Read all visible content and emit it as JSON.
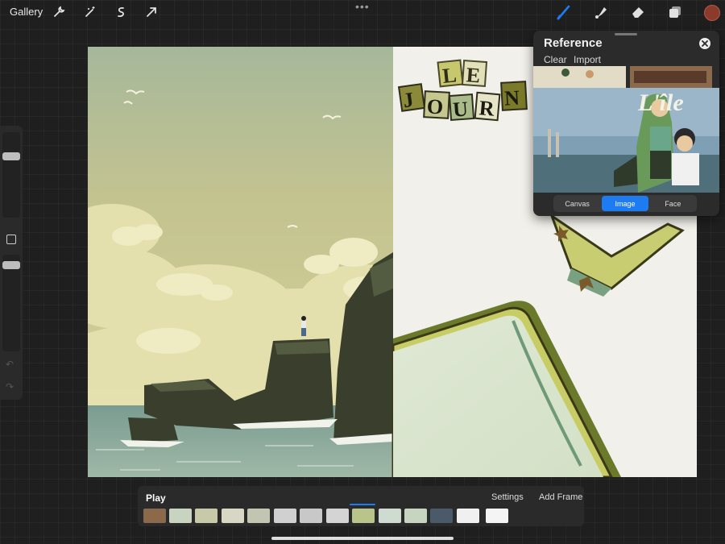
{
  "toolbar": {
    "gallery_label": "Gallery",
    "left_icons": [
      "wrench-icon",
      "magic-wand-icon",
      "selection-icon",
      "transform-arrow-icon"
    ],
    "right_icons": [
      "brush-icon",
      "smudge-icon",
      "eraser-icon",
      "layers-icon"
    ],
    "active_color": "#8a3b2c",
    "accent_color": "#1e7cf2"
  },
  "canvas": {
    "title_letters": [
      "L",
      "E",
      "J",
      "O",
      "U",
      "R",
      "N"
    ]
  },
  "reference": {
    "title": "Reference",
    "clear_label": "Clear",
    "import_label": "Import",
    "image_text": "L'île",
    "tabs": [
      {
        "label": "Canvas",
        "active": false
      },
      {
        "label": "Image",
        "active": true
      },
      {
        "label": "Face",
        "active": false
      }
    ]
  },
  "animation": {
    "play_label": "Play",
    "settings_label": "Settings",
    "add_frame_label": "Add Frame",
    "frame_count": 14,
    "selected_frame": 9
  }
}
